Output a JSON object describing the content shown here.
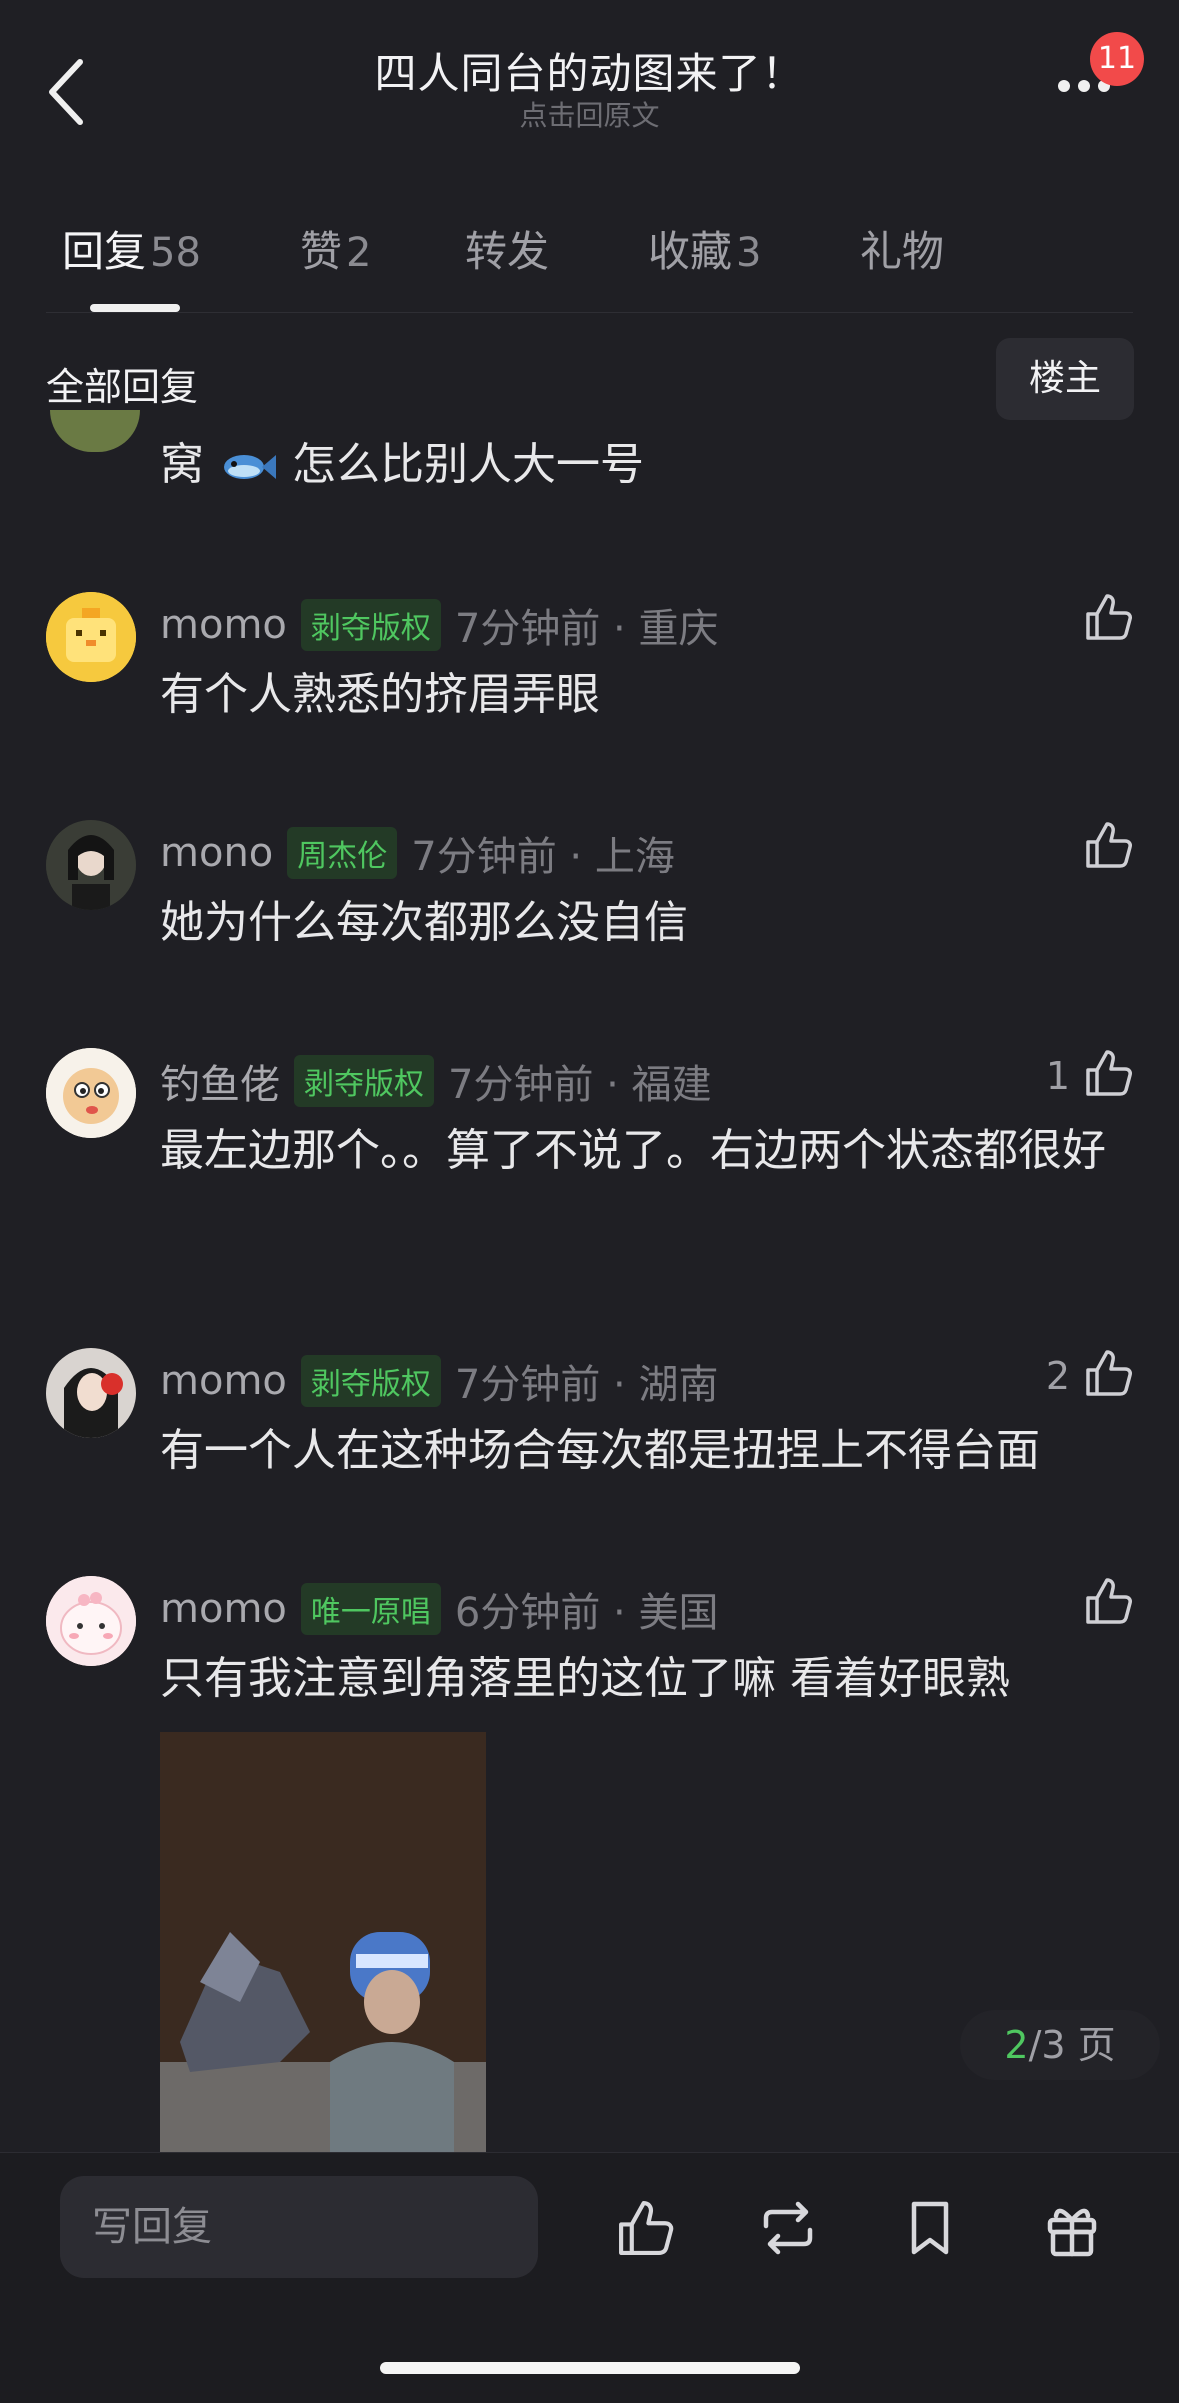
{
  "header": {
    "title": "四人同台的动图来了！",
    "subtitle": "点击回原文",
    "notification_count": "11"
  },
  "tabs": [
    {
      "label": "回复",
      "count": "58"
    },
    {
      "label": "赞",
      "count": "2"
    },
    {
      "label": "转发",
      "count": ""
    },
    {
      "label": "收藏",
      "count": "3"
    },
    {
      "label": "礼物",
      "count": ""
    }
  ],
  "section": {
    "label": "全部回复",
    "owner_button": "楼主"
  },
  "partial_comment": {
    "text_before": "窝",
    "text_after": "怎么比别人大一号"
  },
  "comments": [
    {
      "user": "momo",
      "tag": "剥夺版权",
      "meta": "7分钟前 · 重庆",
      "text": "有个人熟悉的挤眉弄眼",
      "likes": ""
    },
    {
      "user": "mono",
      "tag": "周杰伦",
      "meta": "7分钟前 · 上海",
      "text": "她为什么每次都那么没自信",
      "likes": ""
    },
    {
      "user": "钓鱼佬",
      "tag": "剥夺版权",
      "meta": "7分钟前 · 福建",
      "text": "最左边那个。。算了不说了。右边两个状态都很好",
      "likes": "1"
    },
    {
      "user": "momo",
      "tag": "剥夺版权",
      "meta": "7分钟前 · 湖南",
      "text": "有一个人在这种场合每次都是扭捏上不得台面",
      "likes": "2"
    },
    {
      "user": "momo",
      "tag": "唯一原唱",
      "meta": "6分钟前 · 美国",
      "text": "只有我注意到角落里的这位了嘛 看着好眼熟",
      "likes": ""
    }
  ],
  "pager": {
    "current": "2",
    "total_text": "/3 页"
  },
  "bottom_bar": {
    "reply_placeholder": "写回复"
  },
  "colors": {
    "background": "#1f1f24",
    "tag_green": "#4fc760",
    "badge_red": "#f24a4a"
  }
}
